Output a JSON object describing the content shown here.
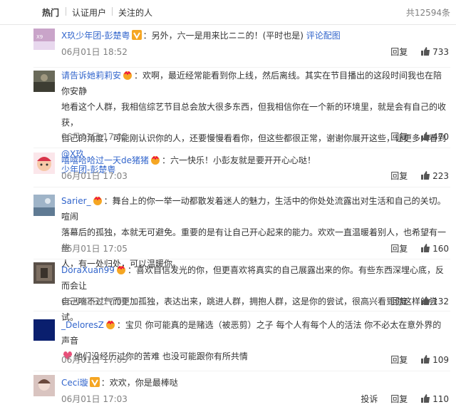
{
  "tabs": {
    "hot": "热门",
    "verified": "认证用户",
    "following": "关注的人"
  },
  "total_count": "共12594条",
  "comments": [
    {
      "user": "X玖少年团-彭楚粤",
      "text": "：另外，六一是用来比ニニ的！(平时也是)",
      "link": "评论配图",
      "time": "06月01日 18:52",
      "reply": "回复",
      "likes": "733"
    },
    {
      "user": "请告诉她莉莉安",
      "text_lines": [
        "：欢啊，最近经常能看到你上线，然后离线。其实在节目播出的这段时间我也在陪你安静",
        "地看这个人群，我相信综艺节目总会放大很多东西，但我相信你在一个新的环境里，就是会有自己的收获，",
        "自己的角度，可能刚认识你的人，还要慢慢看看你，但这些都很正常，谢谢你展开这些，让更多人看到"
      ],
      "mention": "@X玖",
      "mention2": "少年团-彭楚粤",
      "time": "06月01日 17:05",
      "reply": "回复",
      "likes": "470"
    },
    {
      "user": "嘻嘻哈哈过一天de猪猪",
      "text": "：六一快乐！小彭友就是要开开心心哒！",
      "time": "06月01日 17:03",
      "reply": "回复",
      "likes": "223"
    },
    {
      "user": "Sarier_",
      "text_lines": [
        "：舞台上的你一举一动都散发着迷人的魅力，生活中的你处处流露出对生活和自己的关切。喧闹",
        "落幕后的孤独，本就无可避免。重要的是有让自己开心起来的能力。欢欢一直温暖着别人，也希望有一些",
        "人，有一处归处，可以温暖你。"
      ],
      "time": "06月01日 17:05",
      "reply": "回复",
      "likes": "160"
    },
    {
      "user": "DoraXuan99",
      "text_lines": [
        "：喜欢自信发光的你，但更喜欢将真实的自己展露出来的你。有些东西深埋心底，反而会让",
        "自己喘不过气而更加孤独，表达出来，跳进人群，拥抱人群，这是你的尝试，很高兴看到你这样的尝试。"
      ],
      "time": "06月01日 17:08",
      "reply": "回复",
      "likes": "132"
    },
    {
      "user": "_DeloresZ",
      "text_lines": [
        "：宝贝 你可能真的是赌选（被恶剪）之子 每个人有每个人的活法 你不必太在意外界的声音",
        "他们没经历过你的苦难 也没可能跟你有所共情"
      ],
      "time": "06月01日 17:05",
      "reply": "回复",
      "likes": "109"
    },
    {
      "user": "Ceci璇",
      "text": "：欢欢，你是最棒哒",
      "time": "06月01日 17:03",
      "report": "投诉",
      "reply": "回复",
      "likes": "110"
    }
  ]
}
